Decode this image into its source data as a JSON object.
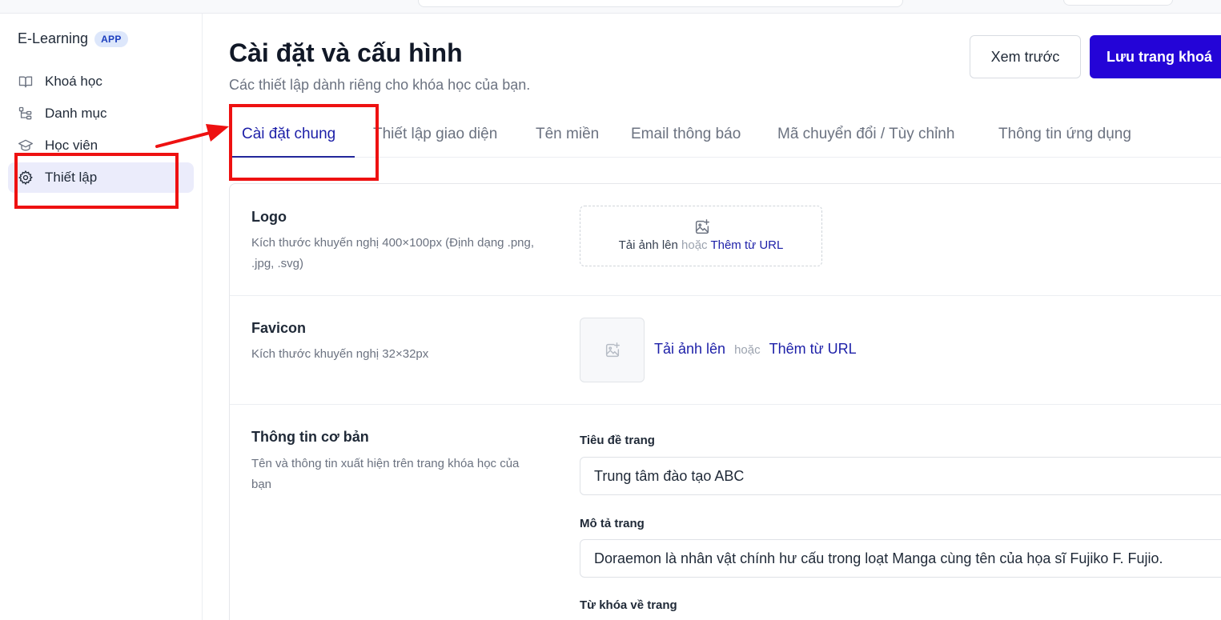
{
  "brand": {
    "name": "E-Learning",
    "badge": "APP"
  },
  "sidebar": {
    "items": [
      {
        "label": "Khoá học",
        "icon": "book-open-icon"
      },
      {
        "label": "Danh mục",
        "icon": "tree-icon"
      },
      {
        "label": "Học viên",
        "icon": "graduation-cap-icon"
      },
      {
        "label": "Thiết lập",
        "icon": "gear-icon",
        "active": true
      }
    ]
  },
  "header": {
    "title": "Cài đặt và cấu hình",
    "subtitle": "Các thiết lập dành riêng cho khóa học của bạn.",
    "preview_label": "Xem trước",
    "save_label": "Lưu trang khoá"
  },
  "tabs": [
    {
      "label": "Cài đặt chung",
      "active": true
    },
    {
      "label": "Thiết lập giao diện"
    },
    {
      "label": "Tên miền"
    },
    {
      "label": "Email thông báo"
    },
    {
      "label": "Mã chuyển đổi / Tùy chỉnh"
    },
    {
      "label": "Thông tin ứng dụng"
    }
  ],
  "logo": {
    "title": "Logo",
    "desc": "Kích thước khuyến nghị 400×100px (Định dạng .png, .jpg, .svg)",
    "upload": "Tải ảnh lên",
    "or": "hoặc",
    "url": "Thêm từ URL"
  },
  "favicon": {
    "title": "Favicon",
    "desc": "Kích thước khuyến nghị 32×32px",
    "upload": "Tải ảnh lên",
    "or": "hoặc",
    "url": "Thêm từ URL"
  },
  "basic": {
    "title": "Thông tin cơ bản",
    "desc": "Tên và thông tin xuất hiện trên trang khóa học của bạn",
    "page_title_label": "Tiêu đề trang",
    "page_title_value": "Trung tâm đào tạo ABC",
    "page_desc_label": "Mô tả trang",
    "page_desc_value": "Doraemon là nhân vật chính hư cấu trong loạt Manga cùng tên của họa sĩ Fujiko F. Fujio.",
    "keywords_label": "Từ khóa về trang"
  },
  "colors": {
    "accent": "#2404d7",
    "link": "#1c1fa8",
    "annotation": "#ee1111",
    "active_nav_bg": "#ebecfb"
  }
}
